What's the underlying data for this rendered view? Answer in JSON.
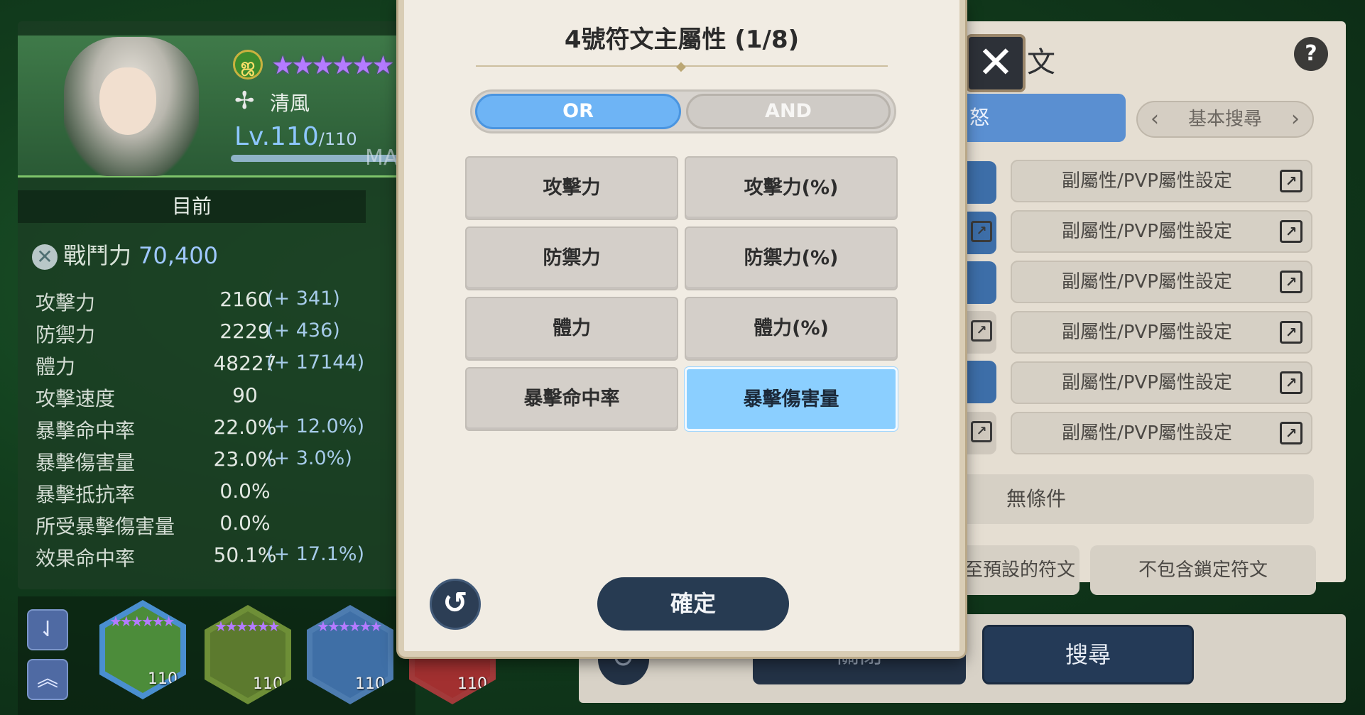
{
  "character": {
    "name": "清風",
    "level_prefix": "Lv.",
    "level": "110",
    "level_max": "/110",
    "max_text": "MA",
    "stars": "★★★★★★",
    "element_icon": "leaf-spiral-icon",
    "class_icon": "cross-icon"
  },
  "current_tab": "目前",
  "power": {
    "label": "戰鬥力",
    "value": "70,400"
  },
  "stats": [
    {
      "name": "攻擊力",
      "value": "2160",
      "bonus": "(+ 341)"
    },
    {
      "name": "防禦力",
      "value": "2229",
      "bonus": "(+ 436)"
    },
    {
      "name": "體力",
      "value": "48227",
      "bonus": "(+ 17144)"
    },
    {
      "name": "攻擊速度",
      "value": "90",
      "bonus": ""
    },
    {
      "name": "暴擊命中率",
      "value": "22.0%",
      "bonus": "(+ 12.0%)"
    },
    {
      "name": "暴擊傷害量",
      "value": "23.0%",
      "bonus": "(+ 3.0%)"
    },
    {
      "name": "暴擊抵抗率",
      "value": "0.0%",
      "bonus": ""
    },
    {
      "name": "所受暴擊傷害量",
      "value": "0.0%",
      "bonus": ""
    },
    {
      "name": "效果命中率",
      "value": "50.1%",
      "bonus": "(+ 17.1%)"
    }
  ],
  "roster": [
    {
      "level": "110",
      "stars": "★★★★★★",
      "color": "#4c8c3a"
    },
    {
      "level": "110",
      "stars": "★★★★★★",
      "color": "#5c7a2e"
    },
    {
      "level": "110",
      "stars": "★★★★★★",
      "color": "#3f6fa6"
    },
    {
      "level": "110",
      "stars": "",
      "color": "#a23030"
    }
  ],
  "modal": {
    "title": "4號符文主屬性 (1/8)",
    "toggle_or": "OR",
    "toggle_and": "AND",
    "options": [
      {
        "label": "攻擊力",
        "selected": false
      },
      {
        "label": "攻擊力(%)",
        "selected": false
      },
      {
        "label": "防禦力",
        "selected": false
      },
      {
        "label": "防禦力(%)",
        "selected": false
      },
      {
        "label": "體力",
        "selected": false
      },
      {
        "label": "體力(%)",
        "selected": false
      },
      {
        "label": "暴擊命中率",
        "selected": false
      },
      {
        "label": "暴擊傷害量",
        "selected": true
      }
    ],
    "confirm": "確定"
  },
  "search_panel": {
    "title_fragment": "文",
    "mode_label": "怒",
    "basic_search": "基本搜尋",
    "sub_attr_label": "副屬性/PVP屬性設定",
    "no_condition": "無條件",
    "preset_runes": "至預設的符文",
    "exclude_locked": "不包含鎖定符文",
    "close_label": "關閉",
    "search_label": "搜尋",
    "help": "?"
  },
  "colors": {
    "selected_option": "#8bcfff",
    "toggle_active": "#6eb4f5",
    "confirm_button": "#273b52"
  }
}
